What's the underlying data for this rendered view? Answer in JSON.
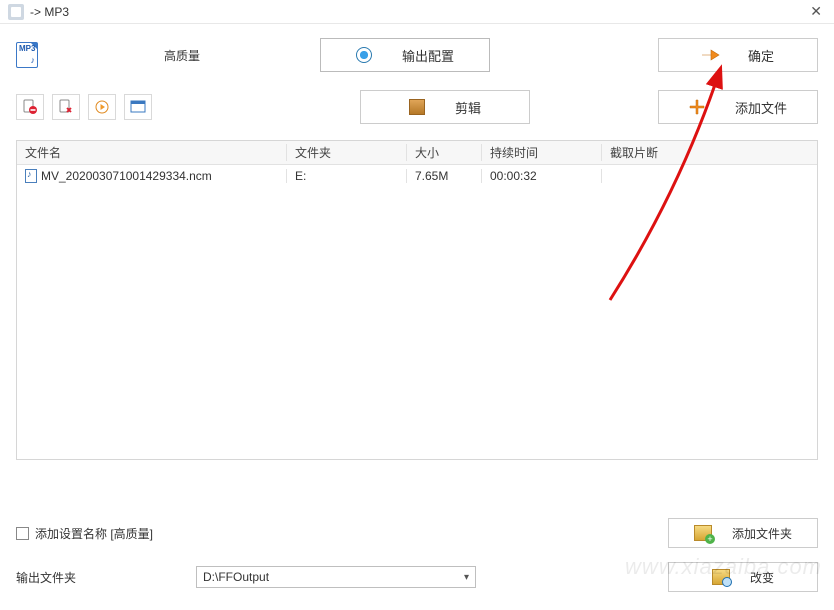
{
  "window": {
    "title": "-> MP3"
  },
  "top": {
    "format": "MP3",
    "quality": "高质量",
    "output_config": "输出配置",
    "ok": "确定",
    "edit": "剪辑",
    "add_file": "添加文件"
  },
  "table": {
    "headers": {
      "name": "文件名",
      "folder": "文件夹",
      "size": "大小",
      "duration": "持续时间",
      "segment": "截取片断"
    },
    "rows": [
      {
        "name": "MV_202003071001429334.ncm",
        "folder": "E:",
        "size": "7.65M",
        "duration": "00:00:32",
        "segment": ""
      }
    ]
  },
  "footer": {
    "add_setting_label": "添加设置名称  [高质量]",
    "add_folder": "添加文件夹",
    "output_folder_label": "输出文件夹",
    "output_folder_value": "D:\\FFOutput",
    "change": "改变"
  },
  "watermark": "www.xiazaiba.com"
}
